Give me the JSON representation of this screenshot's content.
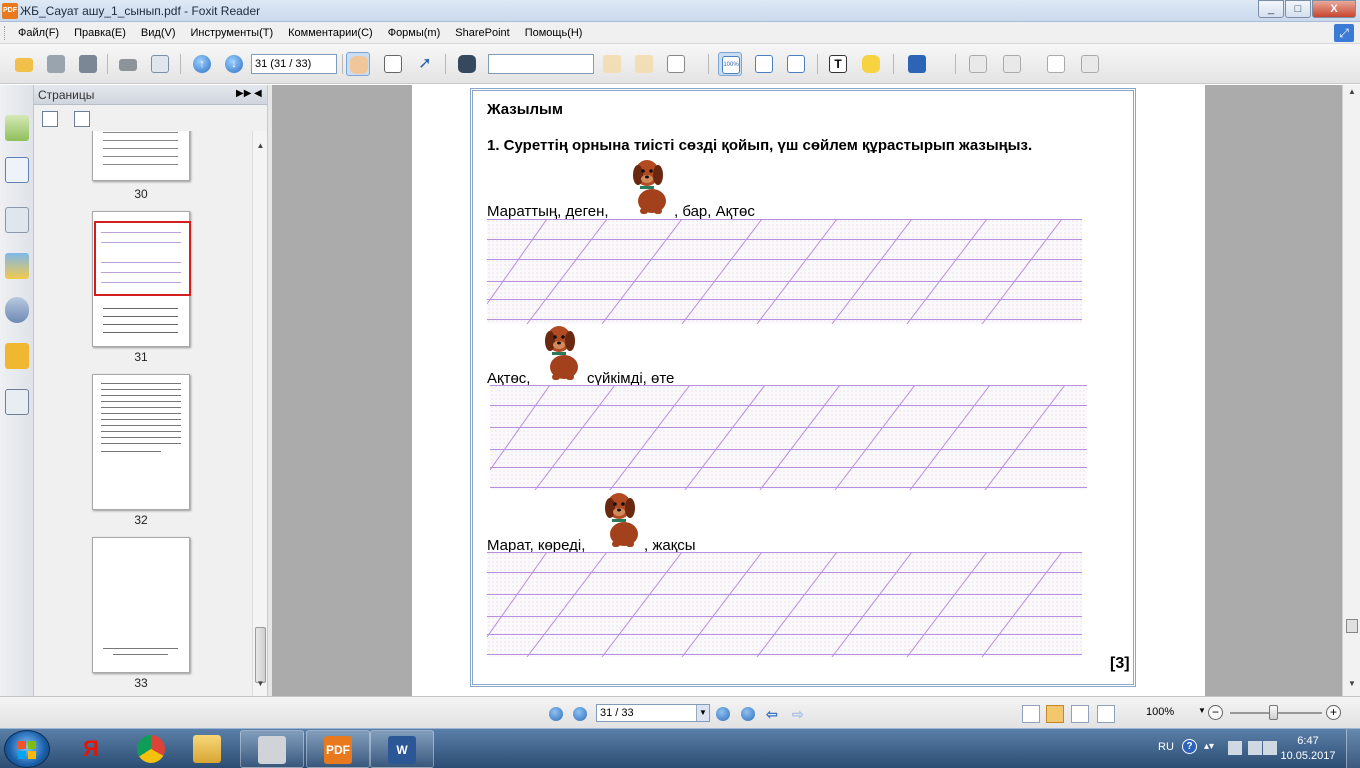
{
  "window": {
    "app_icon": "PDF",
    "title": "ЖБ_Сауат ашу_1_сынып.pdf - Foxit Reader",
    "buttons": [
      "_",
      "□",
      "X"
    ]
  },
  "menu": [
    "Файл(F)",
    "Правка(E)",
    "Вид(V)",
    "Инструменты(T)",
    "Комментарии(C)",
    "Формы(m)",
    "SharePoint",
    "Помощь(H)"
  ],
  "toolbar": {
    "page_field": "31 (31 / 33)",
    "search_value": "",
    "zoom_100": "100%"
  },
  "pages_panel": {
    "title": "Страницы",
    "ctrl_expand": "▶▶",
    "ctrl_collapse": "◀",
    "thumbnails": [
      {
        "label": "30"
      },
      {
        "label": "31",
        "selected": true
      },
      {
        "label": "32"
      },
      {
        "label": "33"
      }
    ]
  },
  "document": {
    "section_title": "Жазылым",
    "task": "1. Суреттің орнына тиісті сөзді қойып, үш сөйлем құрастырып жазыңыз.",
    "sentences": [
      {
        "before": "Мараттың,  деген,",
        "after": ", бар,  Ақтөс"
      },
      {
        "before": "Ақтөс,",
        "after": "сүйкімді, өте"
      },
      {
        "before": "Марат, көреді,",
        "after": ", жақсы"
      }
    ],
    "image": "puppy-picture",
    "score": "[3]"
  },
  "statusbar": {
    "page_combo": "31 / 33",
    "zoom": "100%",
    "zoom_minus": "−",
    "zoom_plus": "+"
  },
  "taskbar": {
    "apps": [
      "Yandex",
      "Chrome",
      "Explorer",
      "Printer",
      "Foxit Reader",
      "Word"
    ],
    "yandex_letter": "Я",
    "word_letter": "W",
    "pdf_text": "PDF",
    "language": "RU",
    "help": "?",
    "time": "6:47",
    "date": "10.05.2017"
  }
}
